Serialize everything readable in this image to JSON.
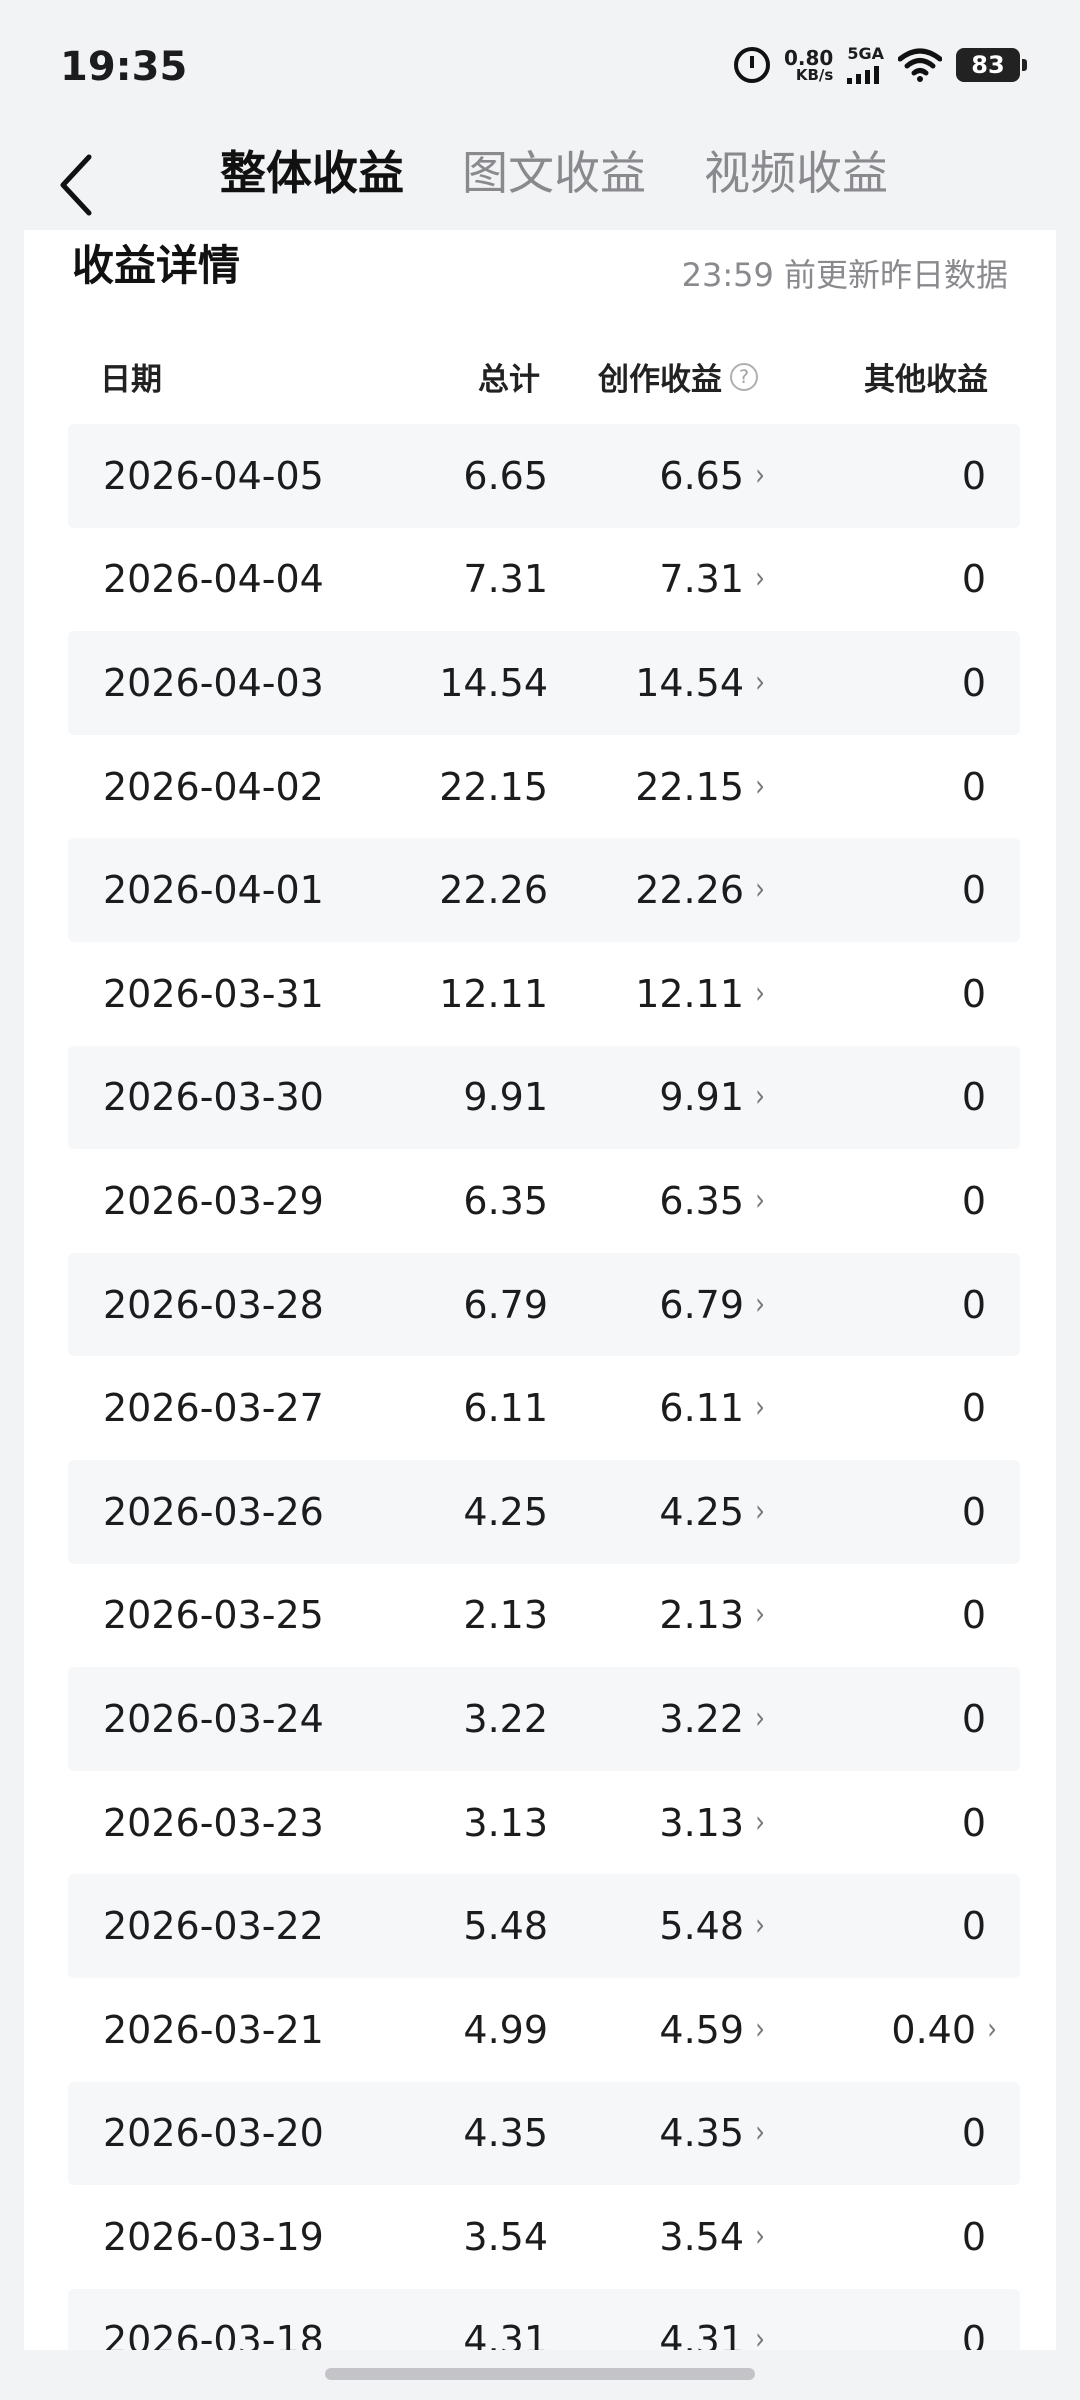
{
  "status_bar": {
    "time": "19:35",
    "net_speed_value": "0.80",
    "net_speed_unit": "KB/s",
    "signal_label": "5GA",
    "battery": "83"
  },
  "header": {
    "tabs": [
      {
        "label": "整体收益",
        "active": true
      },
      {
        "label": "图文收益",
        "active": false
      },
      {
        "label": "视频收益",
        "active": false
      }
    ]
  },
  "card": {
    "title": "收益详情",
    "update_note": "23:59 前更新昨日数据",
    "columns": {
      "date": "日期",
      "total": "总计",
      "creation": "创作收益",
      "other": "其他收益"
    },
    "help_glyph": "?",
    "rows": [
      {
        "date": "2026-04-05",
        "total": "6.65",
        "creation": "6.65",
        "other": "0"
      },
      {
        "date": "2026-04-04",
        "total": "7.31",
        "creation": "7.31",
        "other": "0"
      },
      {
        "date": "2026-04-03",
        "total": "14.54",
        "creation": "14.54",
        "other": "0"
      },
      {
        "date": "2026-04-02",
        "total": "22.15",
        "creation": "22.15",
        "other": "0"
      },
      {
        "date": "2026-04-01",
        "total": "22.26",
        "creation": "22.26",
        "other": "0"
      },
      {
        "date": "2026-03-31",
        "total": "12.11",
        "creation": "12.11",
        "other": "0"
      },
      {
        "date": "2026-03-30",
        "total": "9.91",
        "creation": "9.91",
        "other": "0"
      },
      {
        "date": "2026-03-29",
        "total": "6.35",
        "creation": "6.35",
        "other": "0"
      },
      {
        "date": "2026-03-28",
        "total": "6.79",
        "creation": "6.79",
        "other": "0"
      },
      {
        "date": "2026-03-27",
        "total": "6.11",
        "creation": "6.11",
        "other": "0"
      },
      {
        "date": "2026-03-26",
        "total": "4.25",
        "creation": "4.25",
        "other": "0"
      },
      {
        "date": "2026-03-25",
        "total": "2.13",
        "creation": "2.13",
        "other": "0"
      },
      {
        "date": "2026-03-24",
        "total": "3.22",
        "creation": "3.22",
        "other": "0"
      },
      {
        "date": "2026-03-23",
        "total": "3.13",
        "creation": "3.13",
        "other": "0"
      },
      {
        "date": "2026-03-22",
        "total": "5.48",
        "creation": "5.48",
        "other": "0"
      },
      {
        "date": "2026-03-21",
        "total": "4.99",
        "creation": "4.59",
        "other": "0.40",
        "other_link": true
      },
      {
        "date": "2026-03-20",
        "total": "4.35",
        "creation": "4.35",
        "other": "0"
      },
      {
        "date": "2026-03-19",
        "total": "3.54",
        "creation": "3.54",
        "other": "0"
      },
      {
        "date": "2026-03-18",
        "total": "4.31",
        "creation": "4.31",
        "other": "0"
      }
    ]
  },
  "chevron_glyph": "›"
}
